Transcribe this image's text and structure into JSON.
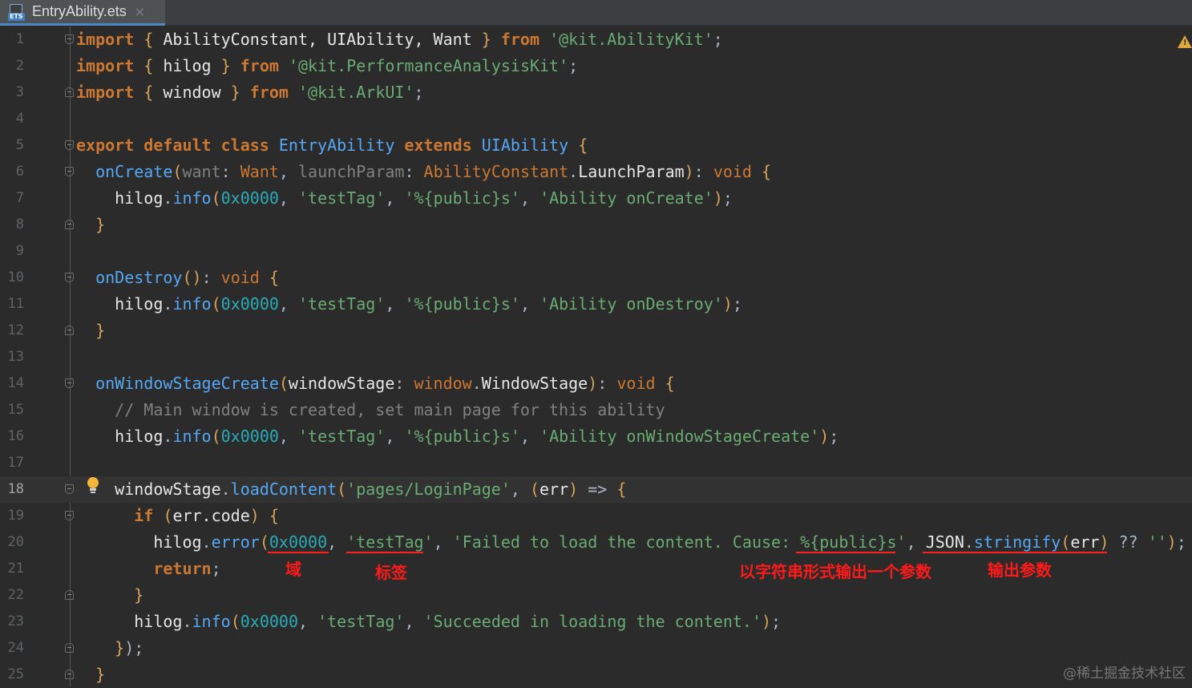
{
  "tab": {
    "label": "EntryAbility.ets",
    "icon": "ets-file-icon",
    "close": "×"
  },
  "lines": [
    {
      "n": "1",
      "tokens": [
        [
          "kw",
          "import"
        ],
        [
          "pu",
          " "
        ],
        [
          "br",
          "{"
        ],
        [
          "wt",
          " AbilityConstant, UIAbility, Want "
        ],
        [
          "br",
          "}"
        ],
        [
          "pu",
          " "
        ],
        [
          "kw",
          "from"
        ],
        [
          "pu",
          " "
        ],
        [
          "str",
          "'@kit.AbilityKit'"
        ],
        [
          "pu",
          ";"
        ]
      ]
    },
    {
      "n": "2",
      "tokens": [
        [
          "kw",
          "import"
        ],
        [
          "pu",
          " "
        ],
        [
          "br",
          "{"
        ],
        [
          "wt",
          " hilog "
        ],
        [
          "br",
          "}"
        ],
        [
          "pu",
          " "
        ],
        [
          "kw",
          "from"
        ],
        [
          "pu",
          " "
        ],
        [
          "str",
          "'@kit.PerformanceAnalysisKit'"
        ],
        [
          "pu",
          ";"
        ]
      ]
    },
    {
      "n": "3",
      "tokens": [
        [
          "kw",
          "import"
        ],
        [
          "pu",
          " "
        ],
        [
          "br",
          "{"
        ],
        [
          "wt",
          " window "
        ],
        [
          "br",
          "}"
        ],
        [
          "pu",
          " "
        ],
        [
          "kw",
          "from"
        ],
        [
          "pu",
          " "
        ],
        [
          "str",
          "'@kit.ArkUI'"
        ],
        [
          "pu",
          ";"
        ]
      ]
    },
    {
      "n": "4",
      "tokens": []
    },
    {
      "n": "5",
      "tokens": [
        [
          "kw",
          "export default class"
        ],
        [
          "pu",
          " "
        ],
        [
          "cls",
          "EntryAbility"
        ],
        [
          "pu",
          " "
        ],
        [
          "kw",
          "extends"
        ],
        [
          "pu",
          " "
        ],
        [
          "cls",
          "UIAbility"
        ],
        [
          "pu",
          " "
        ],
        [
          "br",
          "{"
        ]
      ]
    },
    {
      "n": "6",
      "tokens": [
        [
          "pu",
          "  "
        ],
        [
          "fn",
          "onCreate"
        ],
        [
          "br",
          "("
        ],
        [
          "prm",
          "want"
        ],
        [
          "pu",
          ": "
        ],
        [
          "ty",
          "Want"
        ],
        [
          "pu",
          ", "
        ],
        [
          "prm",
          "launchParam"
        ],
        [
          "pu",
          ": "
        ],
        [
          "ty",
          "AbilityConstant"
        ],
        [
          "pu",
          "."
        ],
        [
          "wt",
          "LaunchParam"
        ],
        [
          "br",
          ")"
        ],
        [
          "pu",
          ": "
        ],
        [
          "kw2",
          "void"
        ],
        [
          "pu",
          " "
        ],
        [
          "br",
          "{"
        ]
      ]
    },
    {
      "n": "7",
      "tokens": [
        [
          "pu",
          "    "
        ],
        [
          "wt",
          "hilog"
        ],
        [
          "pu",
          "."
        ],
        [
          "fn",
          "info"
        ],
        [
          "br",
          "("
        ],
        [
          "num",
          "0x0000"
        ],
        [
          "pu",
          ", "
        ],
        [
          "str",
          "'testTag'"
        ],
        [
          "pu",
          ", "
        ],
        [
          "str",
          "'%{public}s'"
        ],
        [
          "pu",
          ", "
        ],
        [
          "str",
          "'Ability onCreate'"
        ],
        [
          "br",
          ")"
        ],
        [
          "pu",
          ";"
        ]
      ]
    },
    {
      "n": "8",
      "tokens": [
        [
          "pu",
          "  "
        ],
        [
          "br",
          "}"
        ]
      ]
    },
    {
      "n": "9",
      "tokens": []
    },
    {
      "n": "10",
      "tokens": [
        [
          "pu",
          "  "
        ],
        [
          "fn",
          "onDestroy"
        ],
        [
          "br",
          "()"
        ],
        [
          "pu",
          ": "
        ],
        [
          "kw2",
          "void"
        ],
        [
          "pu",
          " "
        ],
        [
          "br",
          "{"
        ]
      ]
    },
    {
      "n": "11",
      "tokens": [
        [
          "pu",
          "    "
        ],
        [
          "wt",
          "hilog"
        ],
        [
          "pu",
          "."
        ],
        [
          "fn",
          "info"
        ],
        [
          "br",
          "("
        ],
        [
          "num",
          "0x0000"
        ],
        [
          "pu",
          ", "
        ],
        [
          "str",
          "'testTag'"
        ],
        [
          "pu",
          ", "
        ],
        [
          "str",
          "'%{public}s'"
        ],
        [
          "pu",
          ", "
        ],
        [
          "str",
          "'Ability onDestroy'"
        ],
        [
          "br",
          ")"
        ],
        [
          "pu",
          ";"
        ]
      ]
    },
    {
      "n": "12",
      "tokens": [
        [
          "pu",
          "  "
        ],
        [
          "br",
          "}"
        ]
      ]
    },
    {
      "n": "13",
      "tokens": []
    },
    {
      "n": "14",
      "tokens": [
        [
          "pu",
          "  "
        ],
        [
          "fn",
          "onWindowStageCreate"
        ],
        [
          "br",
          "("
        ],
        [
          "wt",
          "windowStage"
        ],
        [
          "pu",
          ": "
        ],
        [
          "ty",
          "window"
        ],
        [
          "pu",
          "."
        ],
        [
          "wt",
          "WindowStage"
        ],
        [
          "br",
          ")"
        ],
        [
          "pu",
          ": "
        ],
        [
          "kw2",
          "void"
        ],
        [
          "pu",
          " "
        ],
        [
          "br",
          "{"
        ]
      ]
    },
    {
      "n": "15",
      "tokens": [
        [
          "pu",
          "    "
        ],
        [
          "cmt",
          "// Main window is created, set main page for this ability"
        ]
      ]
    },
    {
      "n": "16",
      "tokens": [
        [
          "pu",
          "    "
        ],
        [
          "wt",
          "hilog"
        ],
        [
          "pu",
          "."
        ],
        [
          "fn",
          "info"
        ],
        [
          "br",
          "("
        ],
        [
          "num",
          "0x0000"
        ],
        [
          "pu",
          ", "
        ],
        [
          "str",
          "'testTag'"
        ],
        [
          "pu",
          ", "
        ],
        [
          "str",
          "'%{public}s'"
        ],
        [
          "pu",
          ", "
        ],
        [
          "str",
          "'Ability onWindowStageCreate'"
        ],
        [
          "br",
          ")"
        ],
        [
          "pu",
          ";"
        ]
      ]
    },
    {
      "n": "17",
      "tokens": []
    },
    {
      "n": "18",
      "current": true,
      "tokens": [
        [
          "pu",
          "    "
        ],
        [
          "wt",
          "windowStage"
        ],
        [
          "pu",
          "."
        ],
        [
          "fn",
          "loadContent"
        ],
        [
          "br",
          "("
        ],
        [
          "str",
          "'pages/LoginPage'"
        ],
        [
          "pu",
          ", "
        ],
        [
          "br",
          "("
        ],
        [
          "wt",
          "err"
        ],
        [
          "br",
          ")"
        ],
        [
          "pu",
          " => "
        ],
        [
          "br",
          "{"
        ]
      ]
    },
    {
      "n": "19",
      "tokens": [
        [
          "pu",
          "      "
        ],
        [
          "kw",
          "if"
        ],
        [
          "pu",
          " "
        ],
        [
          "br",
          "("
        ],
        [
          "wt",
          "err.code"
        ],
        [
          "br",
          ")"
        ],
        [
          "pu",
          " "
        ],
        [
          "br",
          "{"
        ]
      ]
    },
    {
      "n": "20",
      "tokens": [
        [
          "pu",
          "        "
        ],
        [
          "wt",
          "hilog"
        ],
        [
          "pu",
          "."
        ],
        [
          "fn",
          "error"
        ],
        [
          "br",
          "("
        ],
        [
          "num",
          "0x0000"
        ],
        [
          "pu",
          ", "
        ],
        [
          "str",
          "'testTag'"
        ],
        [
          "pu",
          ", "
        ],
        [
          "str",
          "'Failed to load the content. Cause: %{public}s'"
        ],
        [
          "pu",
          ", "
        ],
        [
          "wt",
          "JSON"
        ],
        [
          "pu",
          "."
        ],
        [
          "fn",
          "stringify"
        ],
        [
          "br",
          "("
        ],
        [
          "wt",
          "err"
        ],
        [
          "br",
          ")"
        ],
        [
          "pu",
          " ?? "
        ],
        [
          "str",
          "''"
        ],
        [
          "br",
          ")"
        ],
        [
          "pu",
          ";"
        ]
      ]
    },
    {
      "n": "21",
      "tokens": [
        [
          "pu",
          "        "
        ],
        [
          "kw",
          "return"
        ],
        [
          "pu",
          ";"
        ]
      ]
    },
    {
      "n": "22",
      "tokens": [
        [
          "pu",
          "      "
        ],
        [
          "br",
          "}"
        ]
      ]
    },
    {
      "n": "23",
      "tokens": [
        [
          "pu",
          "      "
        ],
        [
          "wt",
          "hilog"
        ],
        [
          "pu",
          "."
        ],
        [
          "fn",
          "info"
        ],
        [
          "br",
          "("
        ],
        [
          "num",
          "0x0000"
        ],
        [
          "pu",
          ", "
        ],
        [
          "str",
          "'testTag'"
        ],
        [
          "pu",
          ", "
        ],
        [
          "str",
          "'Succeeded in loading the content.'"
        ],
        [
          "br",
          ")"
        ],
        [
          "pu",
          ";"
        ]
      ]
    },
    {
      "n": "24",
      "tokens": [
        [
          "pu",
          "    "
        ],
        [
          "br",
          "}"
        ],
        [
          "pu",
          ");"
        ]
      ]
    },
    {
      "n": "25",
      "tokens": [
        [
          "pu",
          "  "
        ],
        [
          "br",
          "}"
        ]
      ]
    }
  ],
  "annotations": {
    "domain": "域",
    "tag": "标签",
    "format": "以字符串形式输出一个参数",
    "param": "输出参数"
  },
  "warning_icon": "warning-triangle-icon",
  "watermark": "@稀土掘金技术社区",
  "colors": {
    "annotation": "#ff1a1a",
    "background": "#2b2b2b"
  }
}
